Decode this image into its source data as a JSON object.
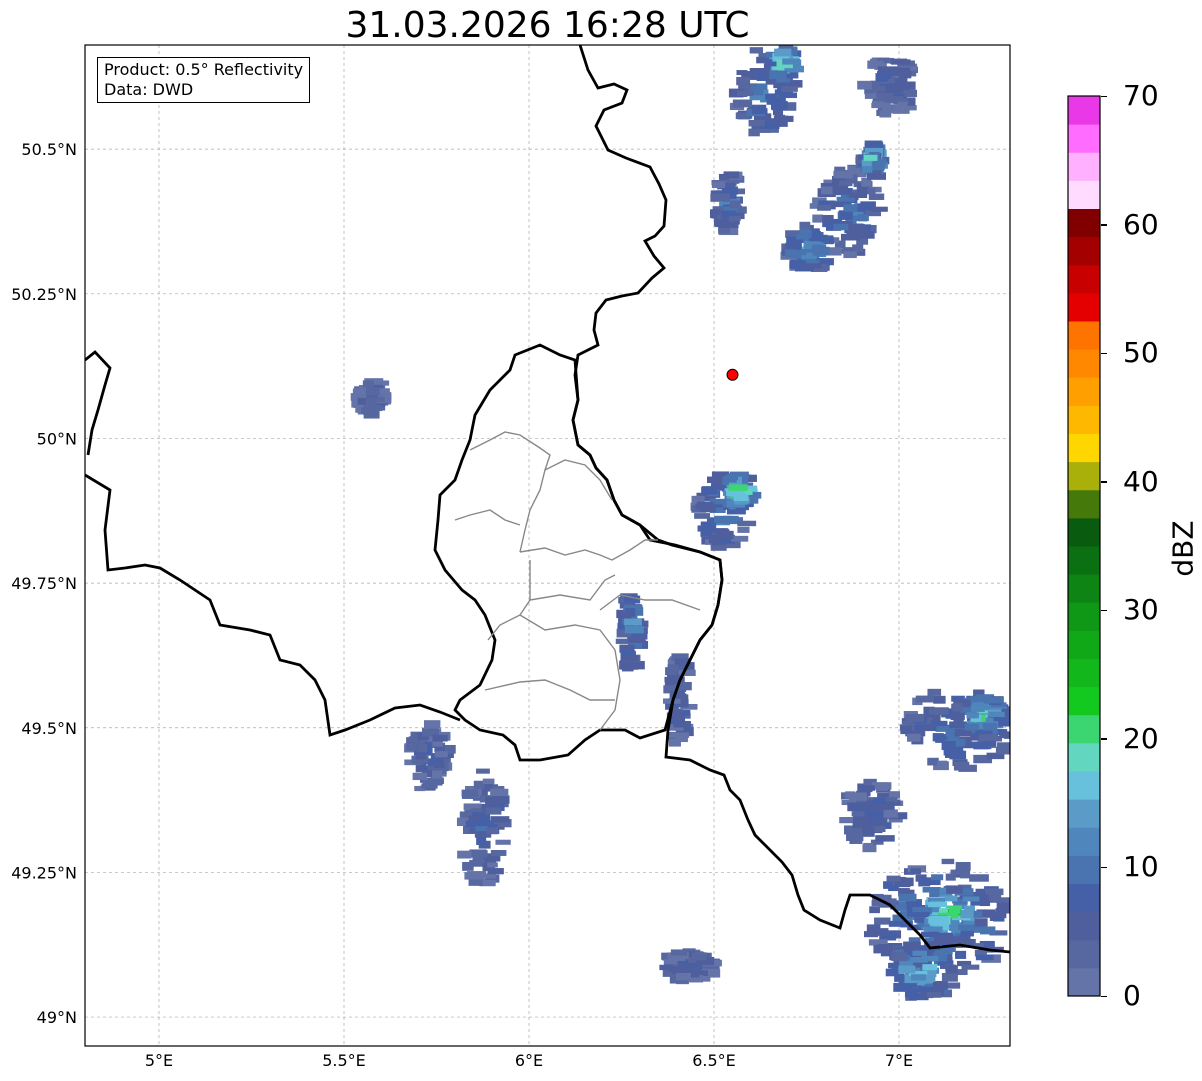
{
  "title": "31.03.2026 16:28 UTC",
  "info": {
    "product": "Product: 0.5° Reflectivity",
    "data": "Data: DWD"
  },
  "map": {
    "lon_range": [
      4.8,
      7.3
    ],
    "lat_range": [
      48.95,
      50.68
    ],
    "lon_ticks": [
      {
        "value": 5.0,
        "label": "5°E"
      },
      {
        "value": 5.5,
        "label": "5.5°E"
      },
      {
        "value": 6.0,
        "label": "6°E"
      },
      {
        "value": 6.5,
        "label": "6.5°E"
      },
      {
        "value": 7.0,
        "label": "7°E"
      }
    ],
    "lat_ticks": [
      {
        "value": 50.5,
        "label": "50.5°N"
      },
      {
        "value": 50.25,
        "label": "50.25°N"
      },
      {
        "value": 50.0,
        "label": "50°N"
      },
      {
        "value": 49.75,
        "label": "49.75°N"
      },
      {
        "value": 49.5,
        "label": "49.5°N"
      },
      {
        "value": 49.25,
        "label": "49.25°N"
      },
      {
        "value": 49.0,
        "label": "49°N"
      }
    ],
    "radar_site": {
      "lon": 6.55,
      "lat": 50.11,
      "color": "#ff0000"
    },
    "gridlines": true
  },
  "colorbar": {
    "label": "dBZ",
    "min": 0,
    "max": 70,
    "step": 2.5,
    "ticks": [
      {
        "value": 0,
        "label": "0"
      },
      {
        "value": 10,
        "label": "10"
      },
      {
        "value": 20,
        "label": "20"
      },
      {
        "value": 30,
        "label": "30"
      },
      {
        "value": 40,
        "label": "40"
      },
      {
        "value": 50,
        "label": "50"
      },
      {
        "value": 60,
        "label": "60"
      },
      {
        "value": 70,
        "label": "70"
      }
    ],
    "colors": [
      "#6474a8",
      "#5767a0",
      "#4f5f9e",
      "#4560a6",
      "#4a74b0",
      "#4f86bc",
      "#5b9bc8",
      "#67c1dc",
      "#63d6c0",
      "#3bd672",
      "#13c81e",
      "#12b81b",
      "#11a818",
      "#0f9816",
      "#0d8414",
      "#0b7012",
      "#095c0f",
      "#457a0a",
      "#aab00a",
      "#ffd600",
      "#ffb800",
      "#ffa000",
      "#ff8800",
      "#ff7400",
      "#e40000",
      "#c80000",
      "#a40000",
      "#800000",
      "#ffdcff",
      "#ffb0ff",
      "#ff6cff",
      "#e838e8"
    ]
  },
  "echoes": [
    {
      "lon": 6.63,
      "lat": 50.6,
      "rx": 0.08,
      "ry": 0.075,
      "dbz": 14
    },
    {
      "lon": 6.68,
      "lat": 50.65,
      "rx": 0.035,
      "ry": 0.03,
      "dbz": 26
    },
    {
      "lon": 6.97,
      "lat": 50.61,
      "rx": 0.07,
      "ry": 0.05,
      "dbz": 8
    },
    {
      "lon": 6.86,
      "lat": 50.39,
      "rx": 0.09,
      "ry": 0.08,
      "dbz": 12
    },
    {
      "lon": 6.75,
      "lat": 50.33,
      "rx": 0.06,
      "ry": 0.04,
      "dbz": 18
    },
    {
      "lon": 6.92,
      "lat": 50.48,
      "rx": 0.025,
      "ry": 0.03,
      "dbz": 24
    },
    {
      "lon": 6.53,
      "lat": 50.41,
      "rx": 0.03,
      "ry": 0.05,
      "dbz": 12
    },
    {
      "lon": 6.52,
      "lat": 49.88,
      "rx": 0.07,
      "ry": 0.07,
      "dbz": 14
    },
    {
      "lon": 6.56,
      "lat": 49.91,
      "rx": 0.035,
      "ry": 0.03,
      "dbz": 26
    },
    {
      "lon": 6.27,
      "lat": 49.67,
      "rx": 0.025,
      "ry": 0.07,
      "dbz": 16
    },
    {
      "lon": 6.4,
      "lat": 49.55,
      "rx": 0.025,
      "ry": 0.08,
      "dbz": 10
    },
    {
      "lon": 5.72,
      "lat": 49.45,
      "rx": 0.05,
      "ry": 0.06,
      "dbz": 8
    },
    {
      "lon": 5.87,
      "lat": 49.33,
      "rx": 0.06,
      "ry": 0.1,
      "dbz": 9
    },
    {
      "lon": 5.57,
      "lat": 50.07,
      "rx": 0.04,
      "ry": 0.03,
      "dbz": 6
    },
    {
      "lon": 7.1,
      "lat": 49.17,
      "rx": 0.19,
      "ry": 0.1,
      "dbz": 17
    },
    {
      "lon": 7.13,
      "lat": 49.18,
      "rx": 0.1,
      "ry": 0.05,
      "dbz": 27
    },
    {
      "lon": 7.05,
      "lat": 49.08,
      "rx": 0.09,
      "ry": 0.05,
      "dbz": 20
    },
    {
      "lon": 7.15,
      "lat": 49.5,
      "rx": 0.15,
      "ry": 0.07,
      "dbz": 12
    },
    {
      "lon": 7.22,
      "lat": 49.52,
      "rx": 0.08,
      "ry": 0.04,
      "dbz": 22
    },
    {
      "lon": 6.92,
      "lat": 49.35,
      "rx": 0.08,
      "ry": 0.06,
      "dbz": 9
    },
    {
      "lon": 6.42,
      "lat": 49.09,
      "rx": 0.07,
      "ry": 0.025,
      "dbz": 8
    }
  ]
}
